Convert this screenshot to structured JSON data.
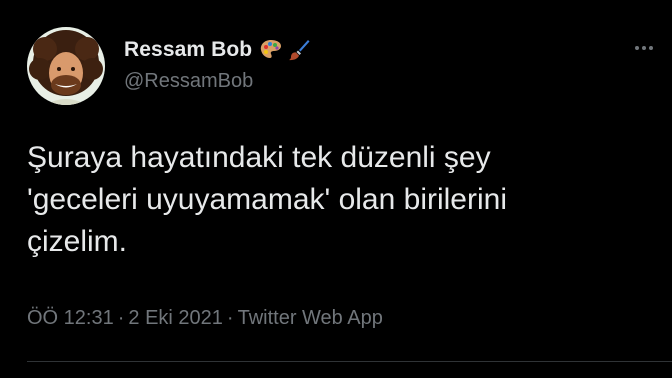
{
  "colors": {
    "background": "#000000",
    "primary_text": "#e7e9ea",
    "secondary_text": "#71767b",
    "divider": "#2f3336"
  },
  "author": {
    "display_name": "Ressam Bob",
    "handle": "@RessamBob",
    "avatar_icon": "bob-ross-portrait",
    "name_emojis": [
      "artist-palette-icon",
      "paintbrush-icon"
    ]
  },
  "tweet": {
    "lines": [
      "Şuraya hayatındaki tek düzenli şey",
      "'geceleri uyuyamamak' olan birilerini",
      "çizelim."
    ]
  },
  "meta": {
    "time": "ÖÖ 12:31",
    "date": "2 Eki 2021",
    "source": "Twitter Web App",
    "separator": "·"
  }
}
